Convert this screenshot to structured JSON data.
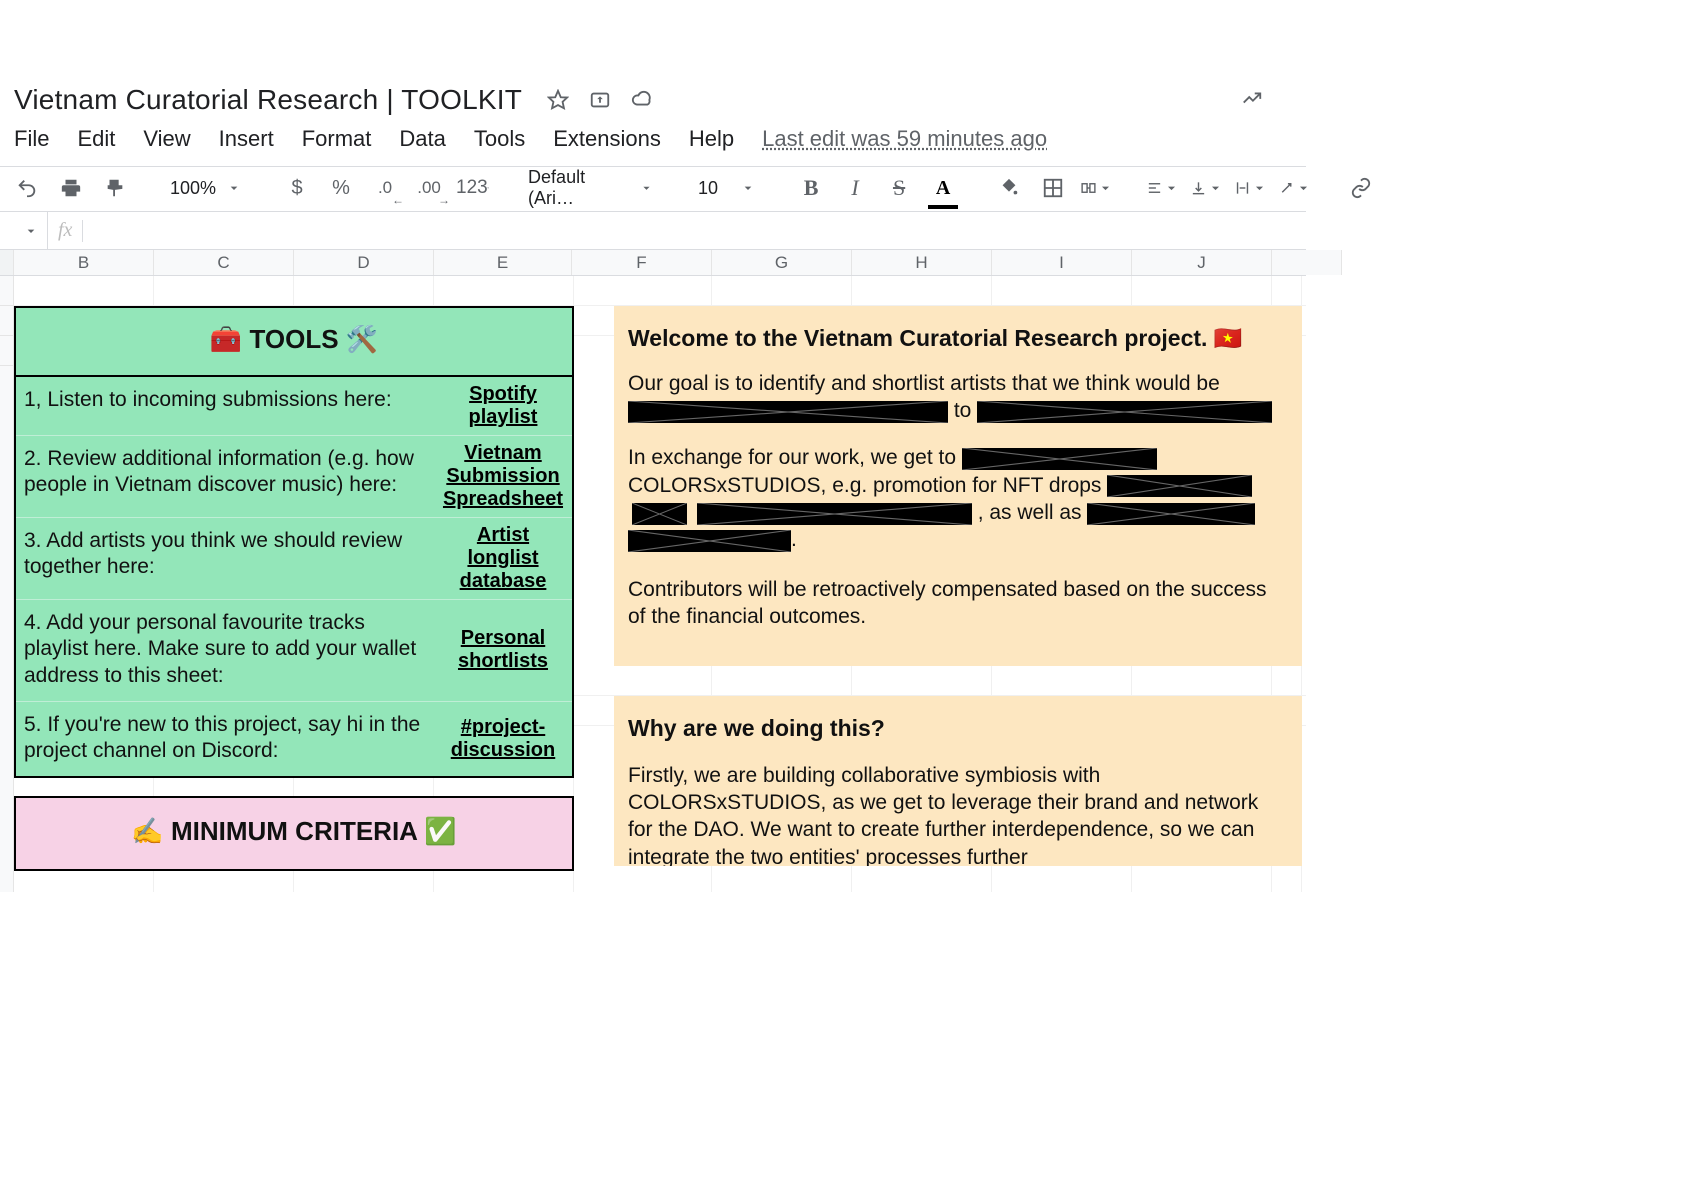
{
  "doc": {
    "title": "Vietnam Curatorial Research | TOOLKIT"
  },
  "menu": {
    "file": "File",
    "edit": "Edit",
    "view": "View",
    "insert": "Insert",
    "format": "Format",
    "data": "Data",
    "tools": "Tools",
    "extensions": "Extensions",
    "help": "Help",
    "last_edit": "Last edit was 59 minutes ago"
  },
  "toolbar": {
    "zoom": "100%",
    "currency": "$",
    "percent": "%",
    "dec_dec": ".0",
    "inc_dec": ".00",
    "num": "123",
    "font": "Default (Ari…",
    "font_size": "10",
    "bold": "B",
    "italic": "I",
    "strike": "S",
    "text_color": "A"
  },
  "fx": {
    "label": "fx"
  },
  "columns": [
    "",
    "B",
    "C",
    "D",
    "E",
    "F",
    "G",
    "H",
    "I",
    "J",
    ""
  ],
  "tools_card": {
    "header": "🧰 TOOLS 🛠️",
    "rows": [
      {
        "text": "1, Listen to incoming submissions here:",
        "link": "Spotify playlist"
      },
      {
        "text": "2. Review additional information (e.g. how people in Vietnam discover music) here:",
        "link": "Vietnam Submission Spreadsheet"
      },
      {
        "text": "3. Add artists you think we should review together here:",
        "link": "Artist longlist database"
      },
      {
        "text": "4. Add your personal favourite tracks playlist here. Make sure to add your wallet address to this sheet:",
        "link": "Personal shortlists"
      },
      {
        "text": "5. If you're new to this project, say hi in the project channel on Discord:",
        "link": "#project-discussion"
      }
    ]
  },
  "criteria_header": "✍️ MINIMUM CRITERIA ✅",
  "note1": {
    "title": "Welcome to the Vietnam Curatorial Research project. 🇻🇳",
    "p1a": "Our goal is to identify and shortlist artists that we think would be ",
    "p1b": " to ",
    "p2a": "In exchange for our work, we get to ",
    "p2b": " COLORSxSTUDIOS, e.g. promotion for NFT drops ",
    "p2c": ", as well as ",
    "p2d": ".",
    "p3": "Contributors will be retroactively compensated based on the success of the financial outcomes."
  },
  "note2": {
    "title": "Why are we doing this?",
    "p1": "Firstly, we are building collaborative symbiosis with COLORSxSTUDIOS, as we get to leverage their brand and network for the DAO. We want to create further interdependence, so we can integrate the two entities' processes further"
  }
}
